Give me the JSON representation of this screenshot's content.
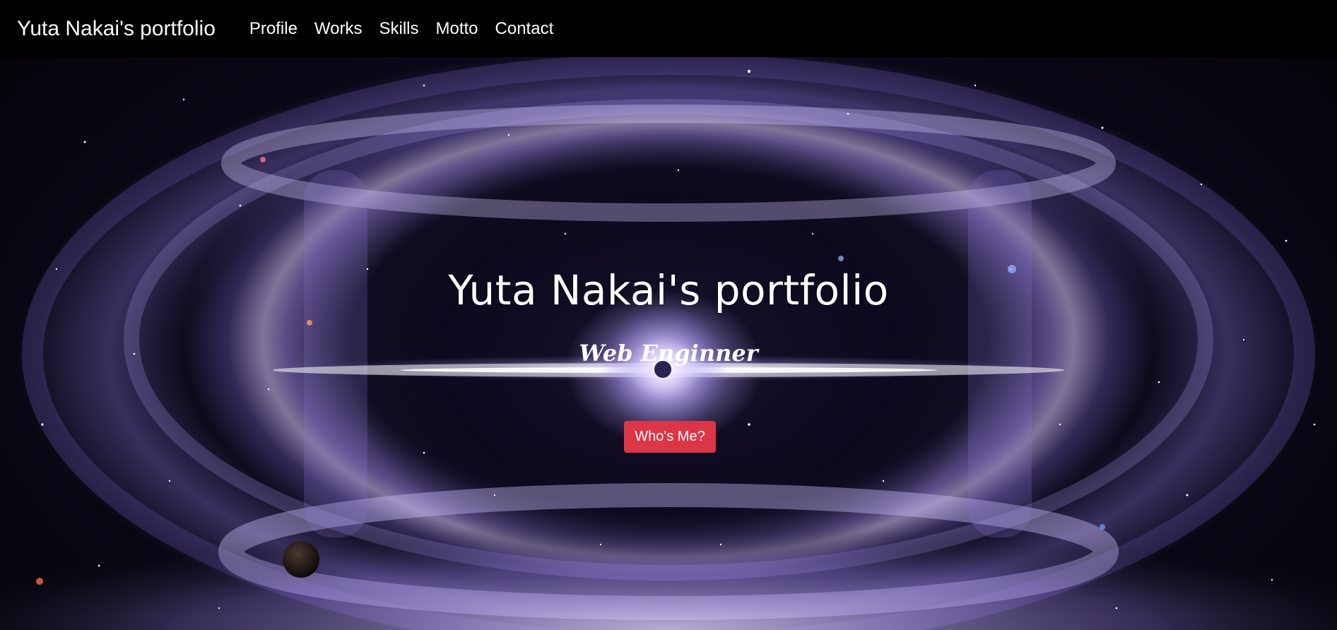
{
  "navbar": {
    "brand": "Yuta Nakai's portfolio",
    "links": [
      {
        "label": "Profile"
      },
      {
        "label": "Works"
      },
      {
        "label": "Skills"
      },
      {
        "label": "Motto"
      },
      {
        "label": "Contact"
      }
    ],
    "background_color": "#000000"
  },
  "hero": {
    "title": "Yuta Nakai's portfolio",
    "subtitle": "Web Enginner",
    "button_label": "Who's Me?",
    "button_color": "#dc3545",
    "background_image": "galaxy-space-image"
  }
}
